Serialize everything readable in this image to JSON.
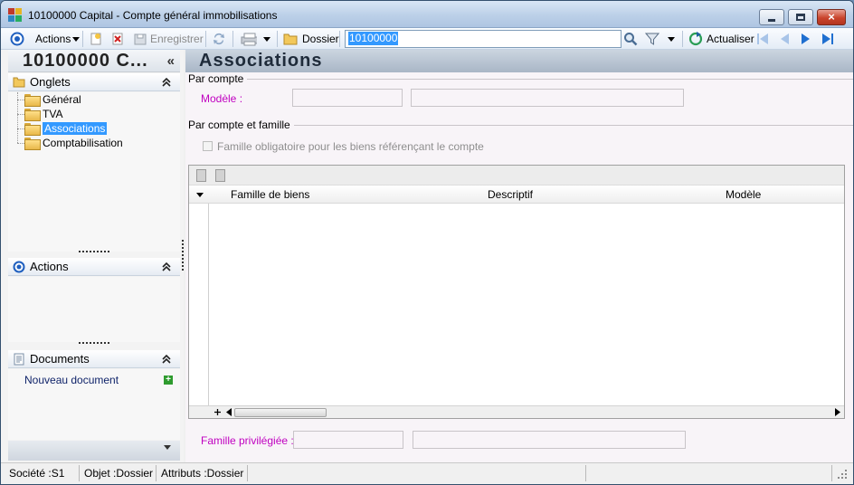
{
  "window": {
    "title": "10100000 Capital -  Compte général immobilisations",
    "close_glyph": "×"
  },
  "toolbar": {
    "actions_label": "Actions",
    "save_label": "Enregistrer",
    "dossier_label": "Dossier",
    "search_value": "10100000",
    "refresh_label": "Actualiser"
  },
  "left": {
    "title": "10100000 C...",
    "collapse_glyph": "«",
    "sections": {
      "onglets": "Onglets",
      "actions": "Actions",
      "documents": "Documents"
    },
    "tabs": [
      {
        "label": "Général"
      },
      {
        "label": "TVA"
      },
      {
        "label": "Associations"
      },
      {
        "label": "Comptabilisation"
      }
    ],
    "new_document_label": "Nouveau document"
  },
  "main": {
    "title": "Associations",
    "group_par_compte": "Par compte",
    "modele_label": "Modèle :",
    "group_par_compte_famille": "Par compte et famille",
    "checkbox_label": "Famille obligatoire pour les biens référençant le compte",
    "grid": {
      "columns": [
        "Famille de biens",
        "Descriptif",
        "Modèle"
      ]
    },
    "famille_privilegiee_label": "Famille privilégiée :"
  },
  "statusbar": {
    "societe": "Société :S1",
    "objet": "Objet :Dossier",
    "attributs": "Attributs :Dossier"
  }
}
